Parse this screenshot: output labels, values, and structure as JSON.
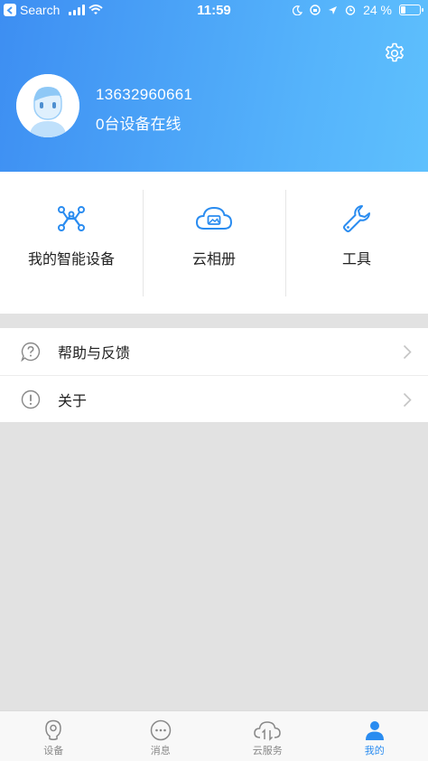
{
  "status_bar": {
    "carrier": "Search",
    "time": "11:59",
    "battery": "24 %",
    "battery_level": 0.24
  },
  "profile": {
    "phone": "13632960661",
    "devices_online": "0台设备在线"
  },
  "tools": [
    {
      "label": "我的智能设备",
      "icon": "smart-device-icon"
    },
    {
      "label": "云相册",
      "icon": "cloud-album-icon"
    },
    {
      "label": "工具",
      "icon": "wrench-icon"
    }
  ],
  "menu": [
    {
      "label": "帮助与反馈",
      "icon": "help-icon"
    },
    {
      "label": "关于",
      "icon": "info-icon"
    }
  ],
  "tabs": [
    {
      "label": "设备",
      "icon": "camera-icon"
    },
    {
      "label": "消息",
      "icon": "message-icon"
    },
    {
      "label": "云服务",
      "icon": "cloud-service-icon"
    },
    {
      "label": "我的",
      "icon": "user-icon"
    }
  ],
  "colors": {
    "accent": "#2a8cf0",
    "header_start": "#3d8ef2",
    "header_end": "#5ec0fd",
    "background": "#e2e2e2"
  }
}
